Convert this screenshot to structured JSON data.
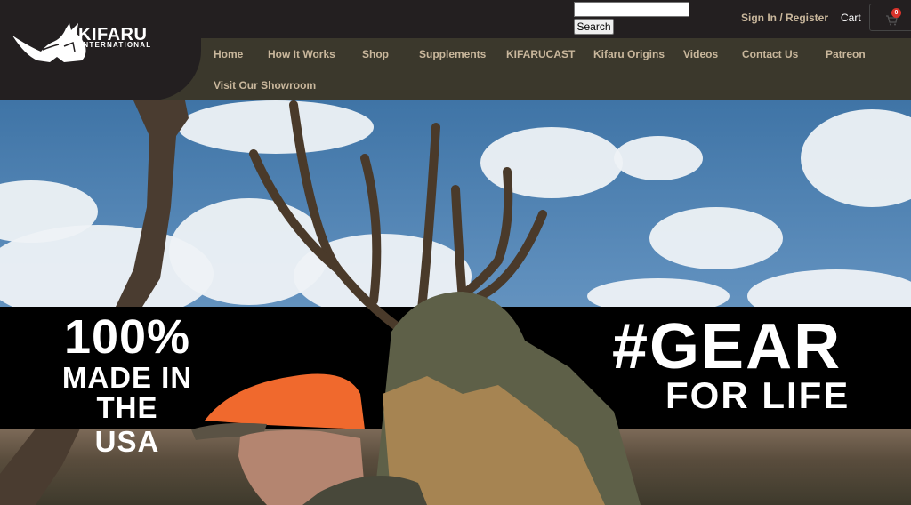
{
  "search": {
    "placeholder": "",
    "value": "",
    "button_label": "Search"
  },
  "account": {
    "signin_label": "Sign In / Register",
    "cart_label": "Cart",
    "cart_count": "0"
  },
  "logo": {
    "name": "KIFARU",
    "subtitle": "INTERNATIONAL"
  },
  "nav": {
    "items": [
      {
        "label": "Home"
      },
      {
        "label": "How It Works"
      },
      {
        "label": "Shop"
      },
      {
        "label": "Supplements"
      },
      {
        "label": "KIFARUCAST"
      },
      {
        "label": "Kifaru Origins"
      },
      {
        "label": "Videos"
      },
      {
        "label": "Contact Us"
      },
      {
        "label": "Patreon"
      },
      {
        "label": "Visit Our Showroom"
      }
    ]
  },
  "hero": {
    "left_line1": "100%",
    "left_line2": "MADE IN",
    "left_line3": "THE USA",
    "right_line1": "#GEAR",
    "right_line2": "FOR LIFE"
  },
  "colors": {
    "header_bg": "#231f20",
    "nav_bg": "#3b382c",
    "nav_text": "#c9b79c",
    "cart_badge": "#d9332b",
    "banner_bg": "#000000",
    "hunter_cap": "#f0692d"
  },
  "icons": {
    "logo": "rhino-logo-icon",
    "cart": "cart-icon"
  }
}
